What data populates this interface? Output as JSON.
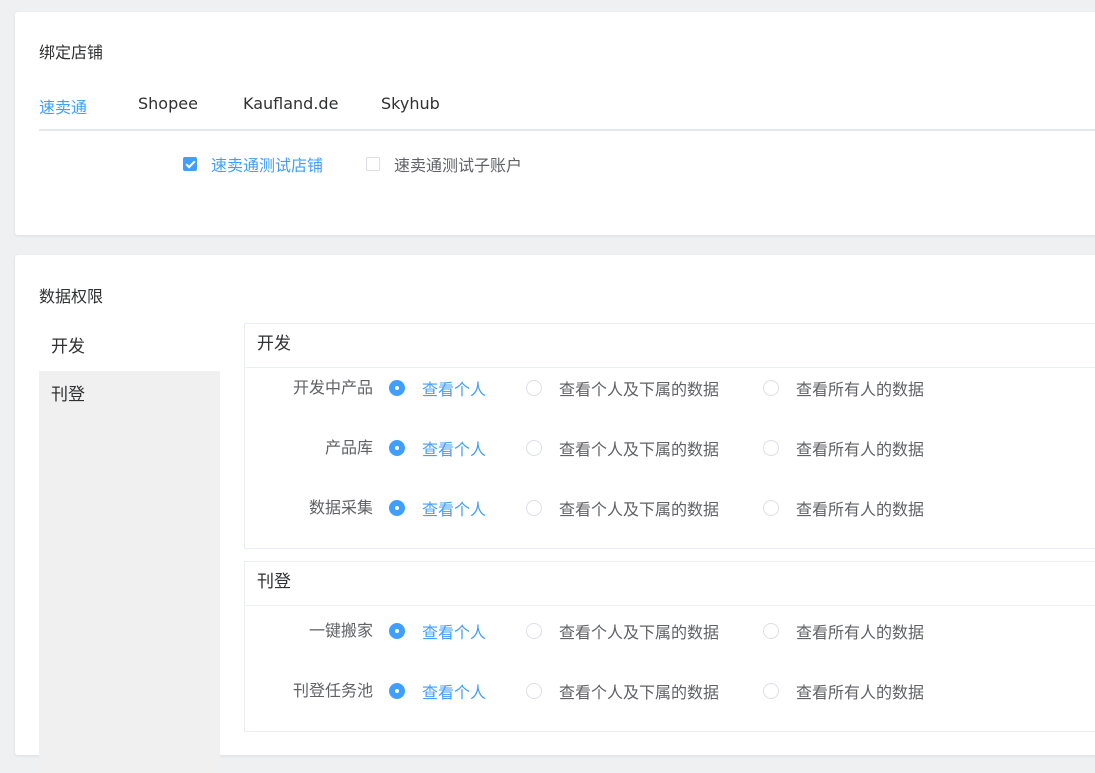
{
  "bind_store": {
    "title": "绑定店铺",
    "tabs": [
      {
        "label": "速卖通",
        "active": true
      },
      {
        "label": "Shopee",
        "active": false
      },
      {
        "label": "Kaufland.de",
        "active": false
      },
      {
        "label": "Skyhub",
        "active": false
      }
    ],
    "stores": [
      {
        "label": "速卖通测试店铺",
        "checked": true
      },
      {
        "label": "速卖通测试子账户",
        "checked": false
      }
    ]
  },
  "data_permission": {
    "title": "数据权限",
    "side_nav": [
      {
        "label": "开发",
        "active": true
      },
      {
        "label": "刊登",
        "active": false
      }
    ],
    "options": [
      "查看个人",
      "查看个人及下属的数据",
      "查看所有人的数据"
    ],
    "sections": [
      {
        "title": "开发",
        "rows": [
          {
            "label": "开发中产品",
            "selected": 0
          },
          {
            "label": "产品库",
            "selected": 0
          },
          {
            "label": "数据采集",
            "selected": 0
          }
        ]
      },
      {
        "title": "刊登",
        "rows": [
          {
            "label": "一键搬家",
            "selected": 0
          },
          {
            "label": "刊登任务池",
            "selected": 0
          }
        ]
      }
    ]
  },
  "colors": {
    "accent": "#409eff",
    "text_primary": "#303133",
    "text_regular": "#606266",
    "background": "#eef0f2",
    "sidebar_bg": "#f0f0f0"
  }
}
